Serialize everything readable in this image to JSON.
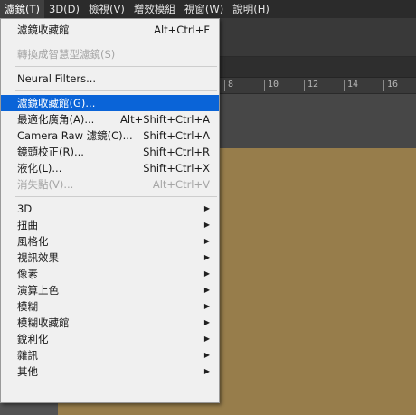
{
  "menubar": {
    "items": [
      {
        "label": "濾鏡(T)",
        "active": true
      },
      {
        "label": "3D(D)"
      },
      {
        "label": "檢視(V)"
      },
      {
        "label": "增效模組"
      },
      {
        "label": "視窗(W)"
      },
      {
        "label": "說明(H)"
      }
    ]
  },
  "ruler": {
    "ticks": [
      "8",
      "10",
      "12",
      "14",
      "16"
    ]
  },
  "filter_menu": {
    "group1": {
      "last_filter": {
        "label": "濾鏡收藏館",
        "shortcut": "Alt+Ctrl+F"
      }
    },
    "group2": {
      "convert_smart": {
        "label": "轉換成智慧型濾鏡(S)"
      }
    },
    "group3": {
      "neural": {
        "label": "Neural Filters..."
      }
    },
    "group4": {
      "gallery": {
        "label": "濾鏡收藏館(G)..."
      },
      "adaptive_wide": {
        "label": "最適化廣角(A)...",
        "shortcut": "Alt+Shift+Ctrl+A"
      },
      "camera_raw": {
        "label": "Camera Raw 濾鏡(C)...",
        "shortcut": "Shift+Ctrl+A"
      },
      "lens_correction": {
        "label": "鏡頭校正(R)...",
        "shortcut": "Shift+Ctrl+R"
      },
      "liquify": {
        "label": "液化(L)...",
        "shortcut": "Shift+Ctrl+X"
      },
      "vanishing_point": {
        "label": "消失點(V)...",
        "shortcut": "Alt+Ctrl+V"
      }
    },
    "submenus": [
      "3D",
      "扭曲",
      "風格化",
      "視訊效果",
      "像素",
      "演算上色",
      "模糊",
      "模糊收藏館",
      "銳利化",
      "雜訊",
      "其他"
    ]
  },
  "colors": {
    "highlight": "#0a64d8",
    "canvas": "#977d4b",
    "menubar": "#2b2b2b"
  }
}
